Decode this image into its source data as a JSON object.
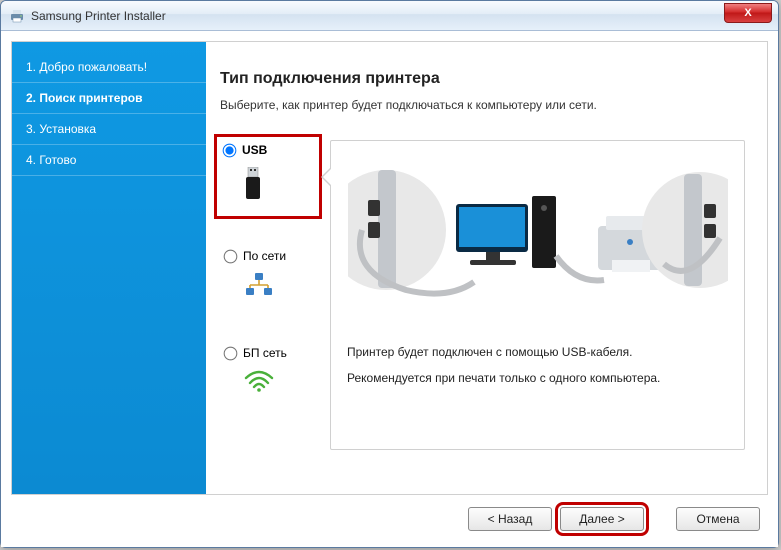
{
  "window": {
    "title": "Samsung Printer Installer"
  },
  "sidebar": {
    "steps": [
      {
        "label": "1. Добро пожаловать!"
      },
      {
        "label": "2. Поиск принтеров"
      },
      {
        "label": "3. Установка"
      },
      {
        "label": "4. Готово"
      }
    ],
    "active_index": 1
  },
  "main": {
    "heading": "Тип подключения принтера",
    "subtext": "Выберите, как принтер будет подключаться к компьютеру или сети.",
    "options": {
      "usb": "USB",
      "network": "По сети",
      "wireless": "БП сеть"
    },
    "selected": "usb",
    "detail": {
      "line1": "Принтер будет подключен с помощью USB-кабеля.",
      "line2": "Рекомендуется при печати только с одного компьютера."
    }
  },
  "footer": {
    "back": "< Назад",
    "next": "Далее >",
    "cancel": "Отмена"
  },
  "close_x": "X"
}
